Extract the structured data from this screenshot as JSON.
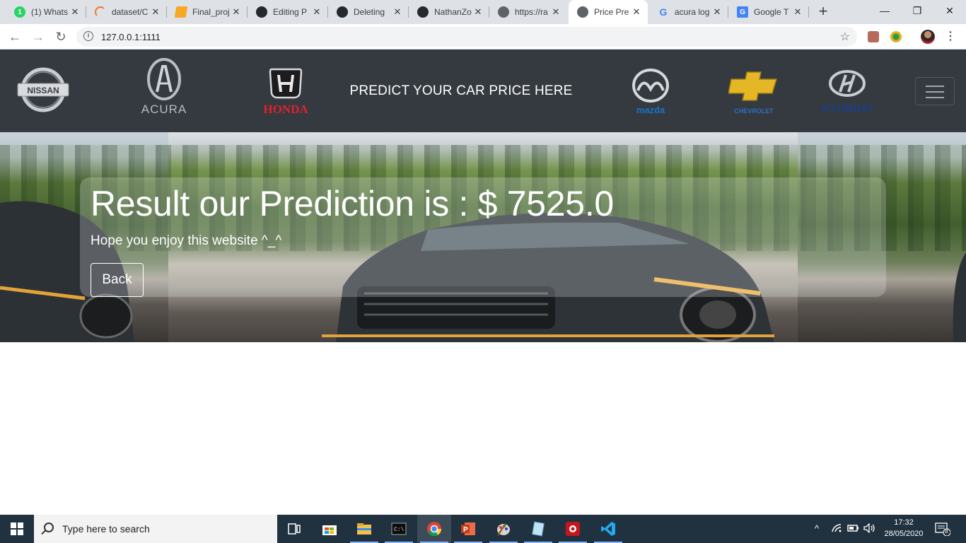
{
  "browser": {
    "tabs": [
      {
        "title": "(1) Whats",
        "icon": "whatsapp-icon",
        "color": "#25d366"
      },
      {
        "title": "dataset/C",
        "icon": "kaggle-spinner-icon",
        "color": "#f37726"
      },
      {
        "title": "Final_proj",
        "icon": "notebook-icon",
        "color": "#f9a825"
      },
      {
        "title": "Editing P",
        "icon": "github-icon",
        "color": "#24292e"
      },
      {
        "title": "Deleting",
        "icon": "github-icon",
        "color": "#24292e"
      },
      {
        "title": "NathanZo",
        "icon": "github-icon",
        "color": "#24292e"
      },
      {
        "title": "https://ra",
        "icon": "globe-icon",
        "color": "#5f6368"
      },
      {
        "title": "Price Pre",
        "icon": "globe-icon",
        "color": "#5f6368"
      },
      {
        "title": "acura log",
        "icon": "google-icon",
        "color": "#4285f4"
      },
      {
        "title": "Google T",
        "icon": "google-translate-icon",
        "color": "#4285f4"
      }
    ],
    "new_tab_label": "+",
    "window_controls": {
      "minimize": "—",
      "restore": "❐",
      "close": "✕"
    },
    "url": "127.0.0.1:1111"
  },
  "navbar": {
    "title": "PREDICT YOUR CAR PRICE HERE",
    "brands_left": [
      {
        "name": "NISSAN",
        "icon": "nissan-logo-icon"
      },
      {
        "name": "ACURA",
        "icon": "acura-logo-icon"
      },
      {
        "name": "HONDA",
        "icon": "honda-logo-icon"
      }
    ],
    "brands_right": [
      {
        "name": "mazda",
        "icon": "mazda-logo-icon"
      },
      {
        "name": "CHEVROLET",
        "icon": "chevrolet-logo-icon"
      },
      {
        "name": "HYUNDAI",
        "icon": "hyundai-logo-icon"
      }
    ]
  },
  "result": {
    "title": "Result our Prediction is : $ 7525.0",
    "subtitle": "Hope you enjoy this website ^_^",
    "back_label": "Back"
  },
  "taskbar": {
    "search_placeholder": "Type here to search",
    "time": "17:32",
    "date": "28/05/2020",
    "notifications": "8",
    "tray_icons": [
      "chevron-up-icon",
      "wifi-icon",
      "battery-icon",
      "volume-icon"
    ],
    "apps": [
      "task-view-icon",
      "store-icon",
      "file-explorer-icon",
      "terminal-icon",
      "chrome-icon",
      "powerpoint-icon",
      "paint-icon",
      "notepad-icon",
      "app-red-icon",
      "vscode-icon"
    ]
  },
  "colors": {
    "navbar_bg": "#343a40",
    "taskbar_bg": "#20313f",
    "honda_red": "#e4202b",
    "mazda_blue": "#1a73c8",
    "chevrolet_gold": "#e5b625",
    "hyundai_blue": "#1b3f8a"
  }
}
